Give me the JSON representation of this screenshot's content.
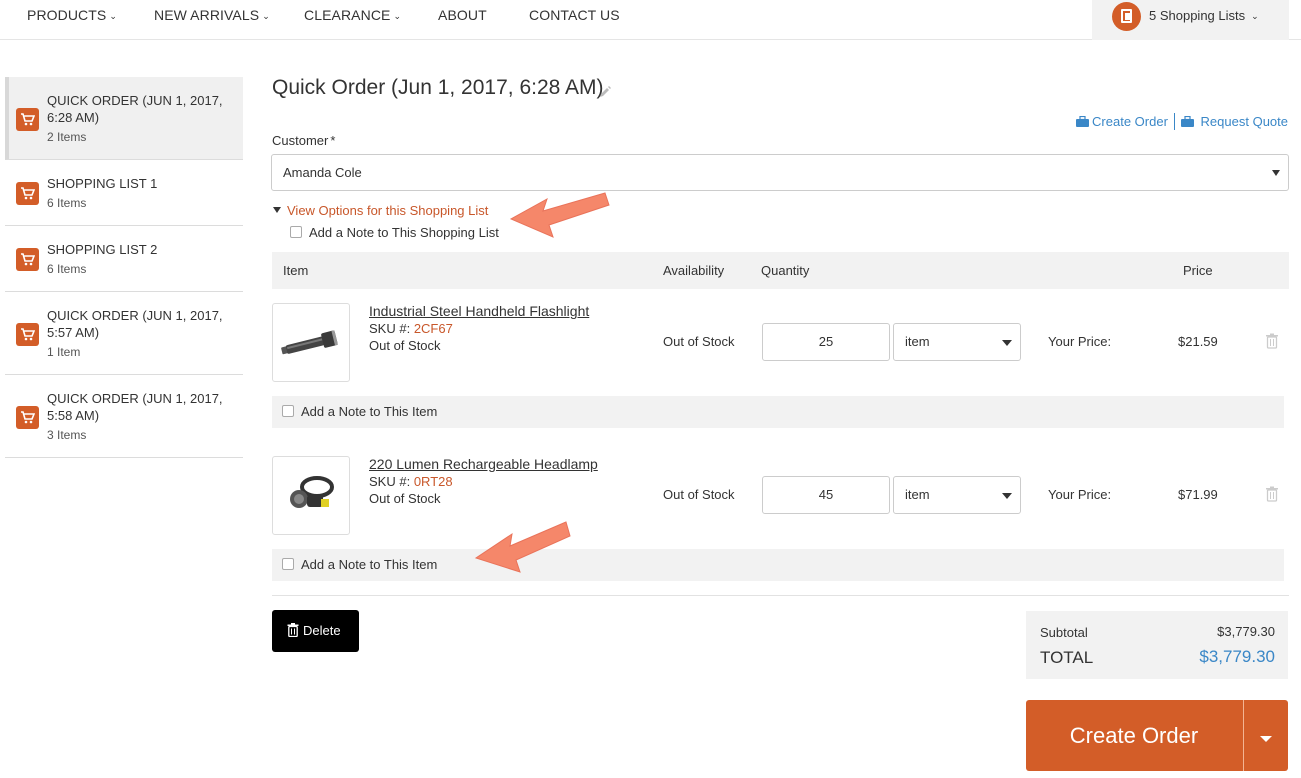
{
  "nav": {
    "items": [
      {
        "label": "PRODUCTS",
        "has_caret": true
      },
      {
        "label": "NEW ARRIVALS",
        "has_caret": true
      },
      {
        "label": "CLEARANCE",
        "has_caret": true
      },
      {
        "label": "ABOUT",
        "has_caret": false
      },
      {
        "label": "CONTACT US",
        "has_caret": false
      }
    ],
    "shopping_lists_label": "5 Shopping Lists"
  },
  "sidebar": {
    "items": [
      {
        "title": "QUICK ORDER (JUN 1, 2017, 6:28 AM)",
        "count": "2 Items",
        "active": true
      },
      {
        "title": "SHOPPING LIST 1",
        "count": "6 Items",
        "active": false
      },
      {
        "title": "SHOPPING LIST 2",
        "count": "6 Items",
        "active": false
      },
      {
        "title": "QUICK ORDER (JUN 1, 2017, 5:57 AM)",
        "count": "1 Item",
        "active": false
      },
      {
        "title": "QUICK ORDER (JUN 1, 2017, 5:58 AM)",
        "count": "3 Items",
        "active": false
      }
    ]
  },
  "main": {
    "title": "Quick Order (Jun 1, 2017, 6:28 AM)",
    "create_order_link": "Create Order",
    "request_quote_link": "Request Quote",
    "customer_label": "Customer",
    "customer_required": "*",
    "customer_value": "Amanda Cole",
    "view_options_link": "View Options for this Shopping List",
    "add_note_list": "Add a Note to This Shopping List"
  },
  "table": {
    "headers": {
      "item": "Item",
      "availability": "Availability",
      "quantity": "Quantity",
      "price": "Price"
    },
    "rows": [
      {
        "name": "Industrial Steel Handheld Flashlight",
        "sku_label": "SKU #:",
        "sku": "2CF67",
        "stock": "Out of Stock",
        "availability": "Out of Stock",
        "quantity": "25",
        "unit": "item",
        "your_price_label": "Your Price:",
        "price": "$21.59",
        "note": "Add a Note to This Item"
      },
      {
        "name": "220 Lumen Rechargeable Headlamp",
        "sku_label": "SKU #:",
        "sku": "0RT28",
        "stock": "Out of Stock",
        "availability": "Out of Stock",
        "quantity": "45",
        "unit": "item",
        "your_price_label": "Your Price:",
        "price": "$71.99",
        "note": "Add a Note to This Item"
      }
    ]
  },
  "footer": {
    "delete_label": "Delete",
    "subtotal_label": "Subtotal",
    "subtotal_value": "$3,779.30",
    "total_label": "TOTAL",
    "total_value": "$3,779.30",
    "create_order_button": "Create Order"
  },
  "colors": {
    "accent": "#d35d28",
    "link_blue": "#3a87c7",
    "annotation_arrow": "#f5876a"
  }
}
